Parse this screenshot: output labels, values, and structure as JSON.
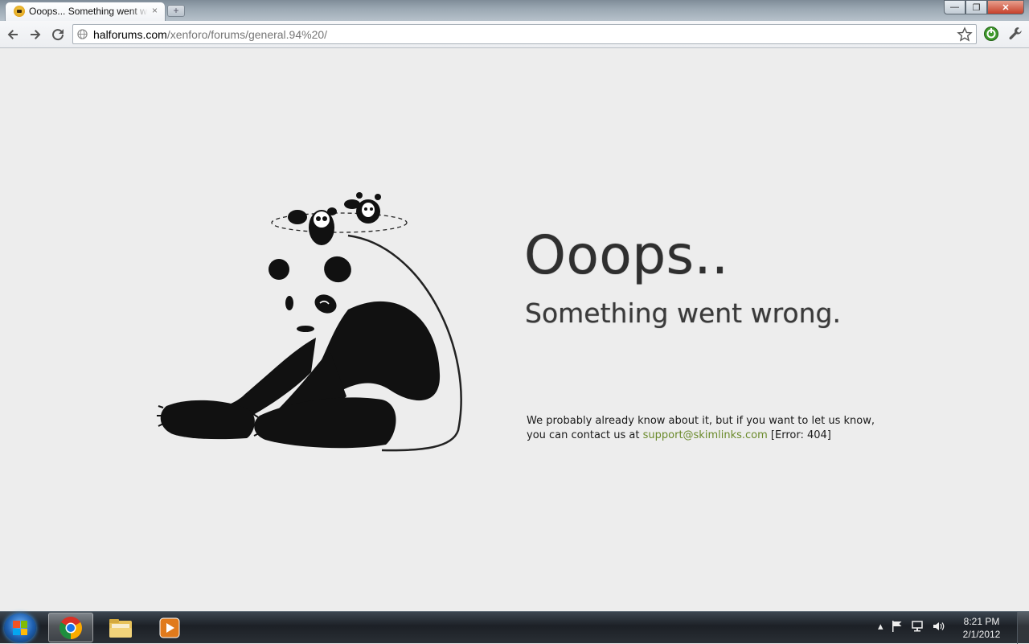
{
  "browser": {
    "tab": {
      "title": "Ooops... Something went wrong.",
      "close_glyph": "×",
      "favicon": "skimlinks-favicon"
    },
    "new_tab_glyph": "+",
    "window_controls": {
      "minimize": "—",
      "maximize": "❐",
      "close": "✕"
    },
    "address": {
      "domain": "halforums.com",
      "path": "/xenforo/forums/general.94%20/"
    },
    "icons": [
      "back-arrow-icon",
      "forward-arrow-icon",
      "reload-icon",
      "globe-icon",
      "bookmark-star-icon",
      "extension-icon",
      "wrench-icon"
    ]
  },
  "page": {
    "heading": "Ooops..",
    "subheading": "Something went wrong.",
    "message_line1": "We probably already know about it, but if you want to let us know,",
    "message_line2_prefix": "you can contact us at ",
    "support_email": "support@skimlinks.com",
    "error_text": " [Error: 404]",
    "link_color": "#6a8a2a",
    "illustration": "sitting-panda-icon"
  },
  "taskbar": {
    "pinned": [
      "windows-start-icon",
      "chrome-icon",
      "explorer-folder-icon",
      "media-player-icon"
    ],
    "tray_icons": [
      "show-hidden-icons",
      "action-center-flag-icon",
      "network-icon",
      "volume-icon"
    ],
    "time": "8:21 PM",
    "date": "2/1/2012"
  }
}
